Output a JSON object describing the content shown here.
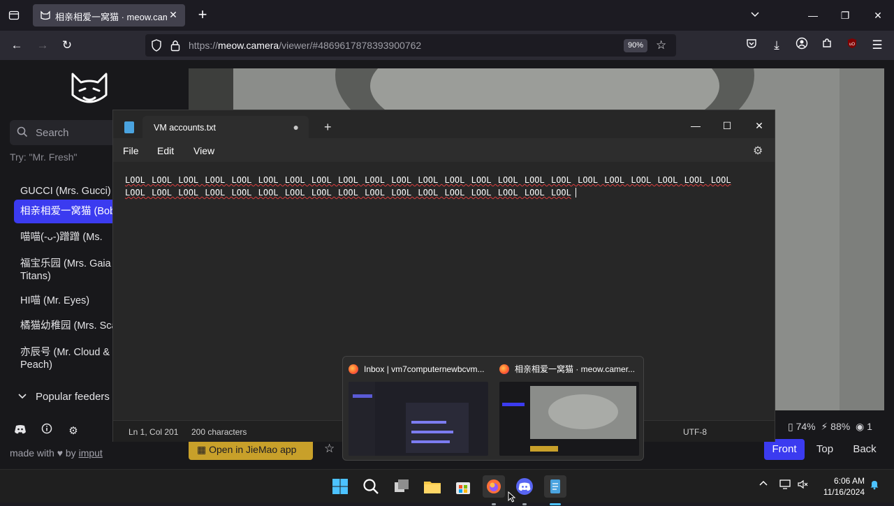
{
  "browser": {
    "tab_title": "相亲相爱一窝猫 · meow.camera",
    "url_prefix": "https://",
    "url_host": "meow.camera",
    "url_path": "/viewer/#4869617878393900762",
    "zoom": "90%"
  },
  "sidebar": {
    "search_placeholder": "Search",
    "try_hint": "Try: \"Mr. Fresh\"",
    "cameras": [
      {
        "label": "GUCCI (Mrs. Gucci)",
        "active": false
      },
      {
        "label": "相亲相爱一窝猫 (Bob",
        "active": true
      },
      {
        "label": "喵喵(-ᴗ-)蹭蹭 (Ms.",
        "active": false
      },
      {
        "label": "福宝乐园 (Mrs. Gaia Titans)",
        "active": false
      },
      {
        "label": "HI喵 (Mr. Eyes)",
        "active": false
      },
      {
        "label": "橘猫幼稚园 (Mrs. Sca",
        "active": false
      },
      {
        "label": "亦辰号 (Mr. Cloud & Peach)",
        "active": false
      }
    ],
    "popular_label": "Popular feeders",
    "made_with": "made with ♥ by",
    "made_with_author": "imput"
  },
  "viewer": {
    "stats_battery": "74%",
    "stats_signal": "88%",
    "stats_viewers": "1",
    "jiemao_label": "Open in JieMao app",
    "views": [
      "Front",
      "Top",
      "Back"
    ],
    "active_view": "Front"
  },
  "notepad": {
    "tab_name": "VM accounts.txt",
    "menu": [
      "File",
      "Edit",
      "View"
    ],
    "line1": "LOOL LOOL LOOL LOOL LOOL LOOL LOOL LOOL LOOL LOOL LOOL LOOL LOOL LOOL LOOL LOOL LOOL LOOL LOOL LOOL LOOL LOOL LOOL",
    "line2": "LOOL LOOL LOOL LOOL LOOL LOOL LOOL LOOL LOOL LOOL LOOL LOOL LOOL LOOL LOOL LOOL LOOL",
    "status_pos": "Ln 1, Col 201",
    "status_chars": "200 characters",
    "status_encoding": "UTF-8"
  },
  "thumbnails": [
    {
      "title": "Inbox | vm7computernewbcvm..."
    },
    {
      "title": "相亲相爱一窝猫 · meow.camer..."
    }
  ],
  "taskbar": {
    "time": "6:06 AM",
    "date": "11/16/2024"
  },
  "colors": {
    "accent": "#3b3bf0",
    "jiemao": "#c8a02a"
  }
}
